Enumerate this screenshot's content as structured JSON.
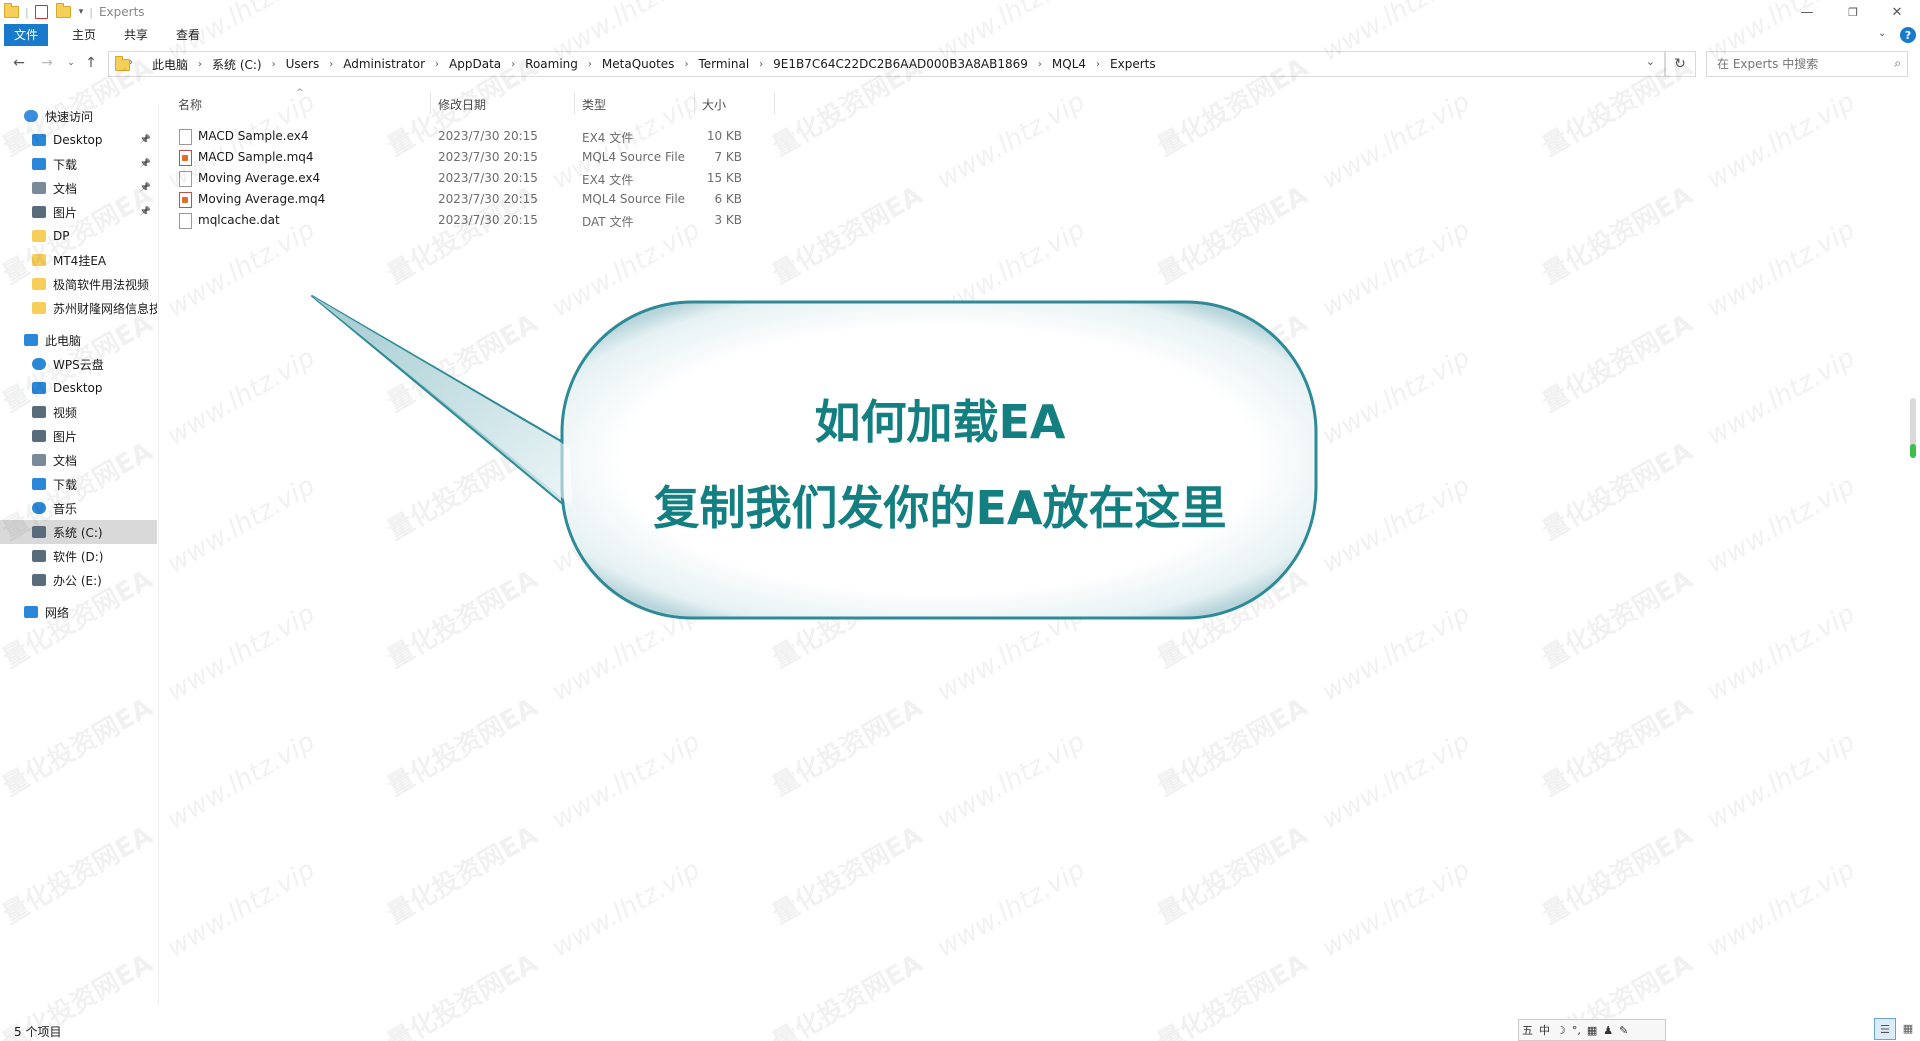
{
  "window": {
    "title": "Experts",
    "controls": {
      "minimize": "—",
      "maximize": "❐",
      "close": "✕"
    }
  },
  "ribbon": {
    "tabs": [
      {
        "label": "文件",
        "active": true
      },
      {
        "label": "主页"
      },
      {
        "label": "共享"
      },
      {
        "label": "查看"
      }
    ]
  },
  "nav": {
    "breadcrumb": [
      "此电脑",
      "系统 (C:)",
      "Users",
      "Administrator",
      "AppData",
      "Roaming",
      "MetaQuotes",
      "Terminal",
      "9E1B7C64C22DC2B6AAD000B3A8AB1869",
      "MQL4",
      "Experts"
    ],
    "search_placeholder": "在 Experts 中搜索"
  },
  "sidebar": {
    "items": [
      {
        "label": "快速访问",
        "icon": "star-icon",
        "color": "#3b8fe0"
      },
      {
        "label": "Desktop",
        "icon": "desktop-icon",
        "color": "#2b88d8",
        "pinned": true
      },
      {
        "label": "下载",
        "icon": "download-icon",
        "color": "#2b88d8",
        "pinned": true
      },
      {
        "label": "文档",
        "icon": "document-icon",
        "color": "#7a8a99",
        "pinned": true
      },
      {
        "label": "图片",
        "icon": "pictures-icon",
        "color": "#5a6b7b",
        "pinned": true
      },
      {
        "label": "DP",
        "icon": "folder-icon",
        "color": "#f6cf5a"
      },
      {
        "label": "MT4挂EA",
        "icon": "folder-icon",
        "color": "#f6cf5a"
      },
      {
        "label": "极简软件用法视频",
        "icon": "folder-icon",
        "color": "#f6cf5a"
      },
      {
        "label": "苏州财隆网络信息技",
        "icon": "folder-icon",
        "color": "#f6cf5a"
      },
      {
        "label": "此电脑",
        "icon": "computer-icon",
        "color": "#2b88d8"
      },
      {
        "label": "WPS云盘",
        "icon": "cloud-icon",
        "color": "#2b88d8"
      },
      {
        "label": "Desktop",
        "icon": "desktop-icon",
        "color": "#2b88d8"
      },
      {
        "label": "视频",
        "icon": "video-icon",
        "color": "#5a6b7b"
      },
      {
        "label": "图片",
        "icon": "pictures-icon",
        "color": "#5a6b7b"
      },
      {
        "label": "文档",
        "icon": "document-icon",
        "color": "#7a8a99"
      },
      {
        "label": "下载",
        "icon": "download-icon",
        "color": "#2b88d8"
      },
      {
        "label": "音乐",
        "icon": "music-icon",
        "color": "#2b88d8"
      },
      {
        "label": "系统 (C:)",
        "icon": "drive-icon",
        "color": "#5a6b7b",
        "selected": true
      },
      {
        "label": "软件 (D:)",
        "icon": "drive-icon",
        "color": "#5a6b7b"
      },
      {
        "label": "办公 (E:)",
        "icon": "drive-icon",
        "color": "#5a6b7b"
      },
      {
        "label": "网络",
        "icon": "network-icon",
        "color": "#2b88d8"
      }
    ]
  },
  "columns": {
    "name": "名称",
    "date": "修改日期",
    "type": "类型",
    "size": "大小"
  },
  "files": [
    {
      "name": "MACD Sample.ex4",
      "date": "2023/7/30 20:15",
      "type": "EX4 文件",
      "size": "10 KB",
      "icon": "file-icon"
    },
    {
      "name": "MACD Sample.mq4",
      "date": "2023/7/30 20:15",
      "type": "MQL4 Source File",
      "size": "7 KB",
      "icon": "mq4-file-icon"
    },
    {
      "name": "Moving Average.ex4",
      "date": "2023/7/30 20:15",
      "type": "EX4 文件",
      "size": "15 KB",
      "icon": "file-icon"
    },
    {
      "name": "Moving Average.mq4",
      "date": "2023/7/30 20:15",
      "type": "MQL4 Source File",
      "size": "6 KB",
      "icon": "mq4-file-icon"
    },
    {
      "name": "mqlcache.dat",
      "date": "2023/7/30 20:15",
      "type": "DAT 文件",
      "size": "3 KB",
      "icon": "file-icon"
    }
  ],
  "callout": {
    "line1": "如何加载EA",
    "line2": "复制我们发你的EA放在这里",
    "text_color": "#137f80",
    "border_color": "#2d8a96"
  },
  "status": {
    "count": "5 个项目"
  },
  "ime": [
    "五",
    "中",
    "☽",
    "°,",
    "▦",
    "♟",
    "✎"
  ],
  "watermark": [
    "量化投资网EA",
    "www.lhtz.vip"
  ]
}
